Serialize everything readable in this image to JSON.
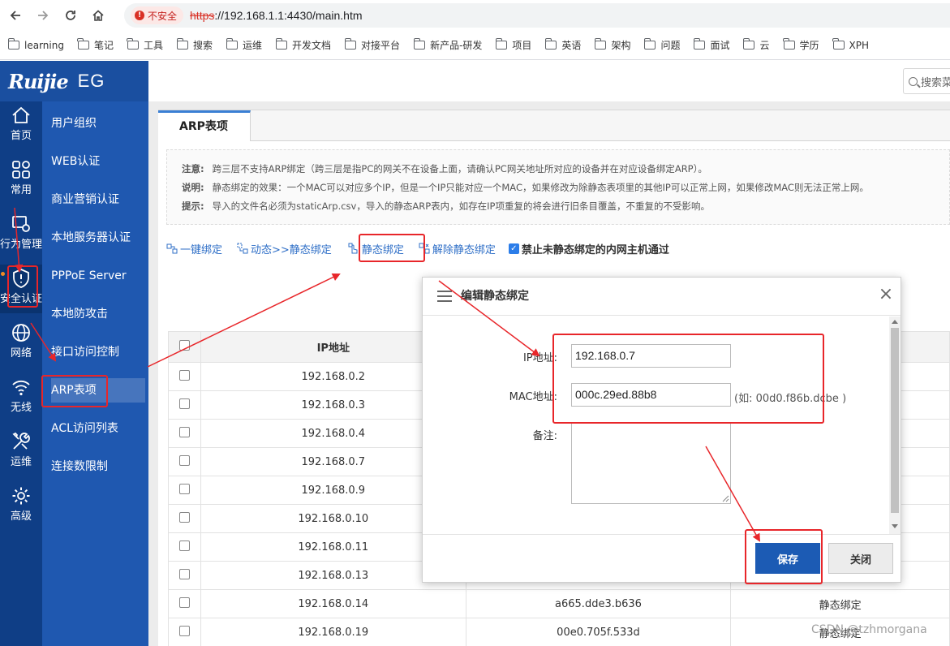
{
  "browser": {
    "security_label": "不安全",
    "url_scheme": "https",
    "url_rest": "://192.168.1.1:4430/main.htm",
    "bookmarks": [
      "learning",
      "笔记",
      "工具",
      "搜索",
      "运维",
      "开发文档",
      "对接平台",
      "新产品-研发",
      "项目",
      "英语",
      "架构",
      "问题",
      "面试",
      "云",
      "学历",
      "XPH"
    ]
  },
  "app": {
    "brand": "Ruijie",
    "model": "EG",
    "search_placeholder": "搜索菜"
  },
  "sidebar": {
    "items": [
      {
        "label": "首页",
        "icon": "home-icon"
      },
      {
        "label": "常用",
        "icon": "grid-icon"
      },
      {
        "label": "行为管理",
        "icon": "monitor-icon"
      },
      {
        "label": "安全认证",
        "icon": "shield-icon"
      },
      {
        "label": "网络",
        "icon": "globe-icon"
      },
      {
        "label": "无线",
        "icon": "wifi-icon"
      },
      {
        "label": "运维",
        "icon": "tools-icon"
      },
      {
        "label": "高级",
        "icon": "gear-icon"
      }
    ],
    "active_index": 3
  },
  "submenu": {
    "items": [
      "用户组织",
      "WEB认证",
      "商业营销认证",
      "本地服务器认证",
      "PPPoE Server",
      "本地防攻击",
      "接口访问控制",
      "ARP表项",
      "ACL访问列表",
      "连接数限制"
    ],
    "active_index": 7
  },
  "page": {
    "tab_label": "ARP表项",
    "notes": [
      {
        "key": "注意:",
        "text": "跨三层不支持ARP绑定（跨三层是指PC的网关不在设备上面，请确认PC网关地址所对应的设备并在对应设备绑定ARP）。"
      },
      {
        "key": "说明:",
        "text": "静态绑定的效果：一个MAC可以对应多个IP，但是一个IP只能对应一个MAC，如果修改为除静态表项里的其他IP可以正常上网，如果修改MAC则无法正常上网。"
      },
      {
        "key": "提示:",
        "text": "导入的文件名必须为staticArp.csv，导入的静态ARP表内，如存在IP项重复的将会进行旧条目覆盖，不重复的不受影响。"
      }
    ],
    "actions": {
      "one_click_bind": "一键绑定",
      "dynamic_to_static": "动态>>静态绑定",
      "static_bind": "静态绑定",
      "unbind_static": "解除静态绑定",
      "block_unbound": "禁止未静态绑定的内网主机通过"
    },
    "table": {
      "header_ip": "IP地址",
      "rows": [
        {
          "ip": "192.168.0.2",
          "mac": "",
          "type": ""
        },
        {
          "ip": "192.168.0.3",
          "mac": "",
          "type": ""
        },
        {
          "ip": "192.168.0.4",
          "mac": "",
          "type": ""
        },
        {
          "ip": "192.168.0.7",
          "mac": "",
          "type": ""
        },
        {
          "ip": "192.168.0.9",
          "mac": "",
          "type": ""
        },
        {
          "ip": "192.168.0.10",
          "mac": "",
          "type": ""
        },
        {
          "ip": "192.168.0.11",
          "mac": "",
          "type": ""
        },
        {
          "ip": "192.168.0.13",
          "mac": "",
          "type": ""
        },
        {
          "ip": "192.168.0.14",
          "mac": "a665.dde3.b636",
          "type": "静态绑定"
        },
        {
          "ip": "192.168.0.19",
          "mac": "00e0.705f.533d",
          "type": "静态绑定"
        }
      ]
    }
  },
  "modal": {
    "title": "编辑静态绑定",
    "ip_label": "IP地址:",
    "ip_value": "192.168.0.7",
    "mac_label": "MAC地址:",
    "mac_value": "000c.29ed.88b8",
    "mac_hint": "(如:   00d0.f86b.dcbe )",
    "remark_label": "备注:",
    "save_label": "保存",
    "close_label": "关闭"
  },
  "watermark": "CSDN @tzhmorgana",
  "colors": {
    "sidebar": "#0f3e86",
    "submenu": "#1f58b0",
    "accent": "#1c5bb4",
    "annotation": "#e8262a"
  }
}
